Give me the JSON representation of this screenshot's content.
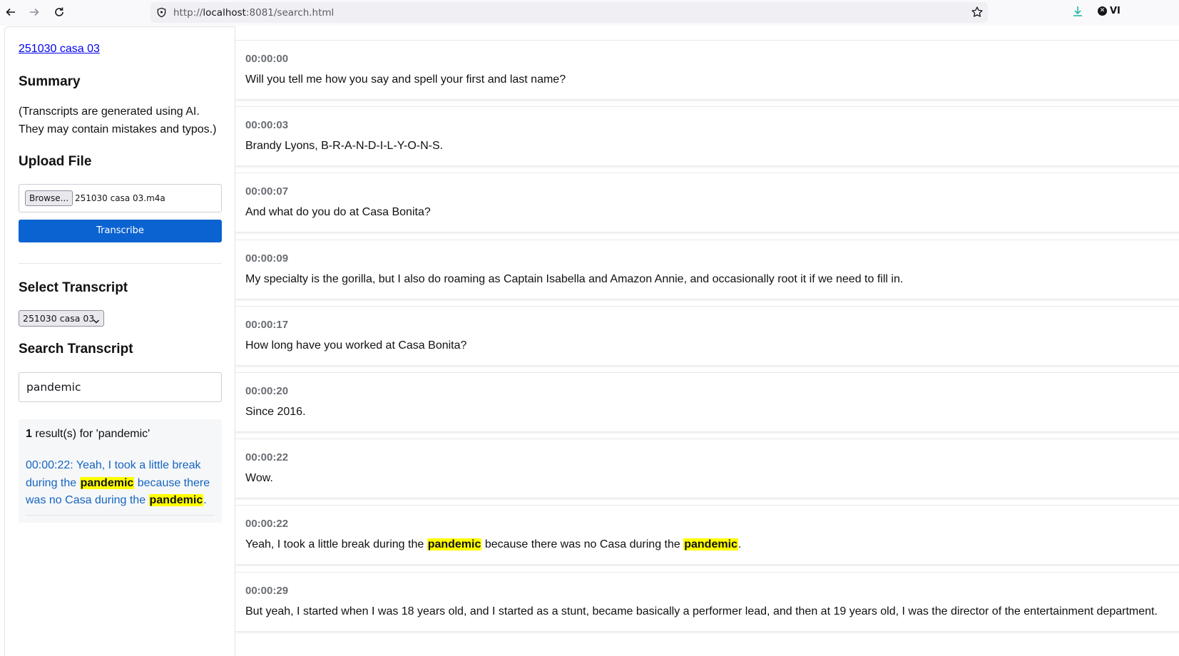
{
  "browser": {
    "url_prefix": "http://",
    "url_host": "localhost",
    "url_rest": ":8081/search.html",
    "extension_label": "VI"
  },
  "sidebar": {
    "file_link": "251030 casa 03",
    "summary_heading": "Summary",
    "disclaimer": "(Transcripts are generated using AI. They may contain mistakes and typos.)",
    "upload_heading": "Upload File",
    "browse_label": "Browse...",
    "selected_file": "251030 casa 03.m4a",
    "transcribe_label": "Transcribe",
    "select_heading": "Select Transcript",
    "selected_transcript": "251030 casa 03",
    "search_heading": "Search Transcript",
    "search_value": "pandemic",
    "results": {
      "count": "1",
      "summary_suffix": " result(s) for 'pandemic'",
      "items": [
        {
          "parts": [
            {
              "text": "00:00:22: Yeah, I took a little break during the "
            },
            {
              "text": "pandemic",
              "highlight": true
            },
            {
              "text": " because there was no Casa during the "
            },
            {
              "text": "pandemic",
              "highlight": true
            },
            {
              "text": "."
            }
          ]
        }
      ]
    }
  },
  "transcript": {
    "segments": [
      {
        "time": "00:00:00",
        "parts": [
          {
            "text": "Will you tell me how you say and spell your first and last name?"
          }
        ]
      },
      {
        "time": "00:00:03",
        "parts": [
          {
            "text": "Brandy Lyons, B-R-A-N-D-I-L-Y-O-N-S."
          }
        ]
      },
      {
        "time": "00:00:07",
        "parts": [
          {
            "text": "And what do you do at Casa Bonita?"
          }
        ]
      },
      {
        "time": "00:00:09",
        "parts": [
          {
            "text": "My specialty is the gorilla, but I also do roaming as Captain Isabella and Amazon Annie, and occasionally root it if we need to fill in."
          }
        ]
      },
      {
        "time": "00:00:17",
        "parts": [
          {
            "text": "How long have you worked at Casa Bonita?"
          }
        ]
      },
      {
        "time": "00:00:20",
        "parts": [
          {
            "text": "Since 2016."
          }
        ]
      },
      {
        "time": "00:00:22",
        "parts": [
          {
            "text": "Wow."
          }
        ]
      },
      {
        "time": "00:00:22",
        "parts": [
          {
            "text": "Yeah, I took a little break during the "
          },
          {
            "text": "pandemic",
            "highlight": true
          },
          {
            "text": " because there was no Casa during the "
          },
          {
            "text": "pandemic",
            "highlight": true
          },
          {
            "text": "."
          }
        ]
      },
      {
        "time": "00:00:29",
        "parts": [
          {
            "text": "But yeah, I started when I was 18 years old, and I started as a stunt, became basically a performer lead, and then at 19 years old, I was the director of the entertainment department."
          }
        ]
      }
    ]
  }
}
